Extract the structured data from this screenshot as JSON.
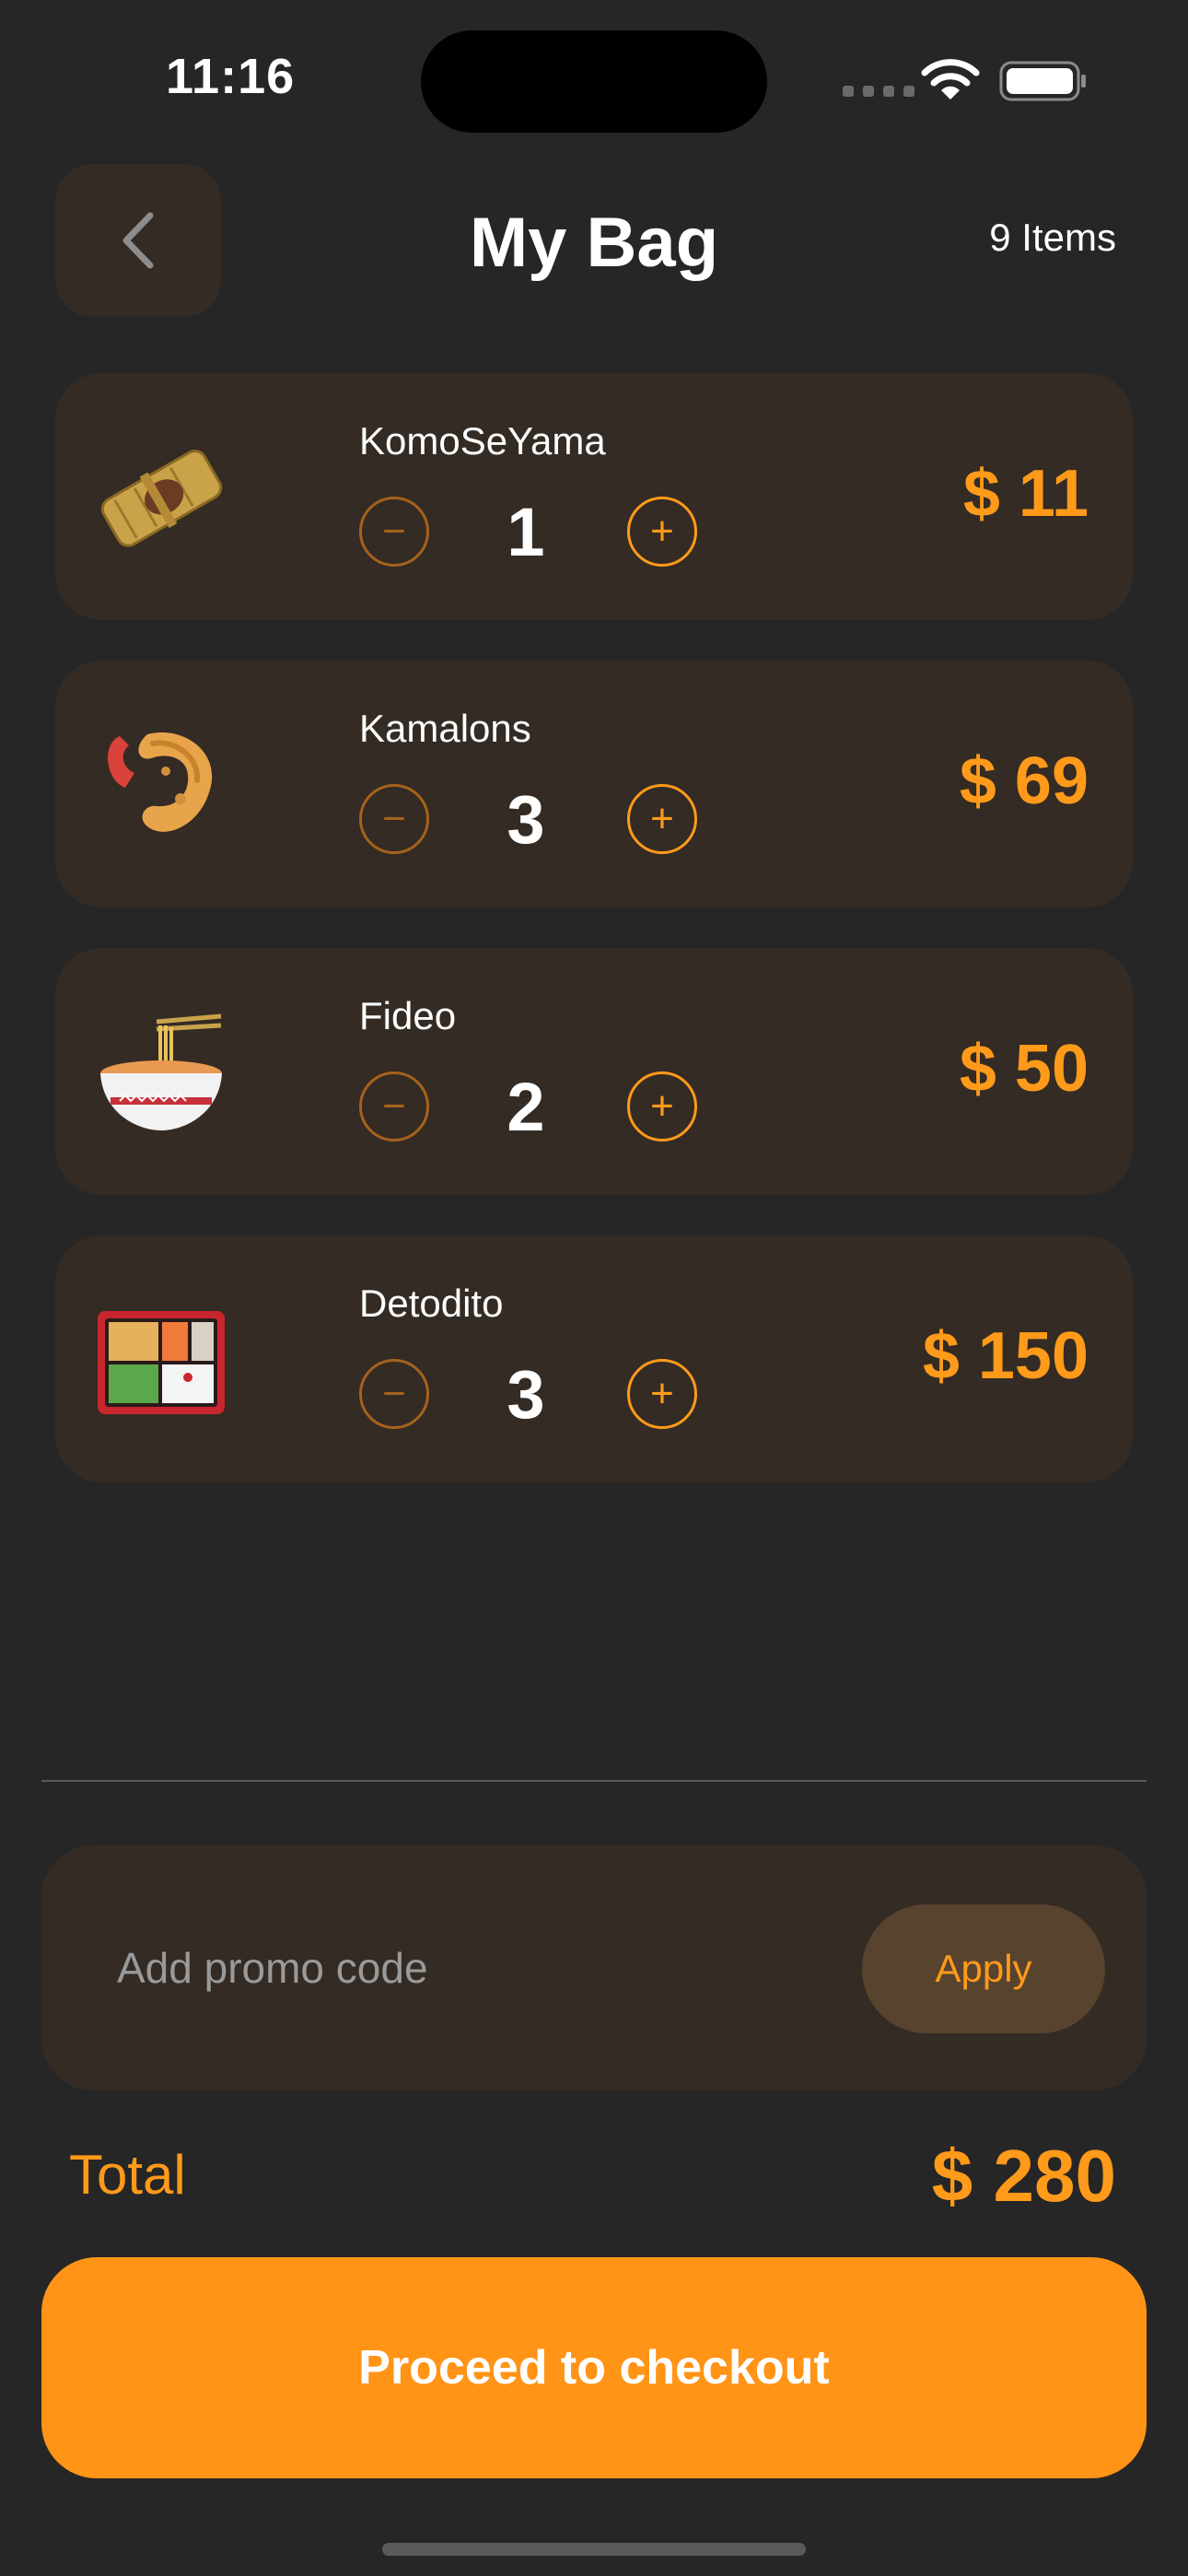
{
  "status_bar": {
    "time": "11:16"
  },
  "header": {
    "title": "My Bag",
    "item_count": "9 Items"
  },
  "cart_items": [
    {
      "name": "KomoSeYama",
      "quantity": "1",
      "price": "$ 11",
      "icon": "tamale-icon"
    },
    {
      "name": "Kamalons",
      "quantity": "3",
      "price": "$ 69",
      "icon": "fried-shrimp-icon"
    },
    {
      "name": "Fideo",
      "quantity": "2",
      "price": "$ 50",
      "icon": "noodle-bowl-icon"
    },
    {
      "name": "Detodito",
      "quantity": "3",
      "price": "$ 150",
      "icon": "bento-box-icon"
    }
  ],
  "promo": {
    "placeholder": "Add promo code",
    "apply_label": "Apply"
  },
  "total": {
    "label": "Total",
    "value": "$ 280"
  },
  "checkout": {
    "label": "Proceed to checkout"
  },
  "colors": {
    "accent": "#ff9417",
    "background": "#262626",
    "card": "#332b24"
  }
}
